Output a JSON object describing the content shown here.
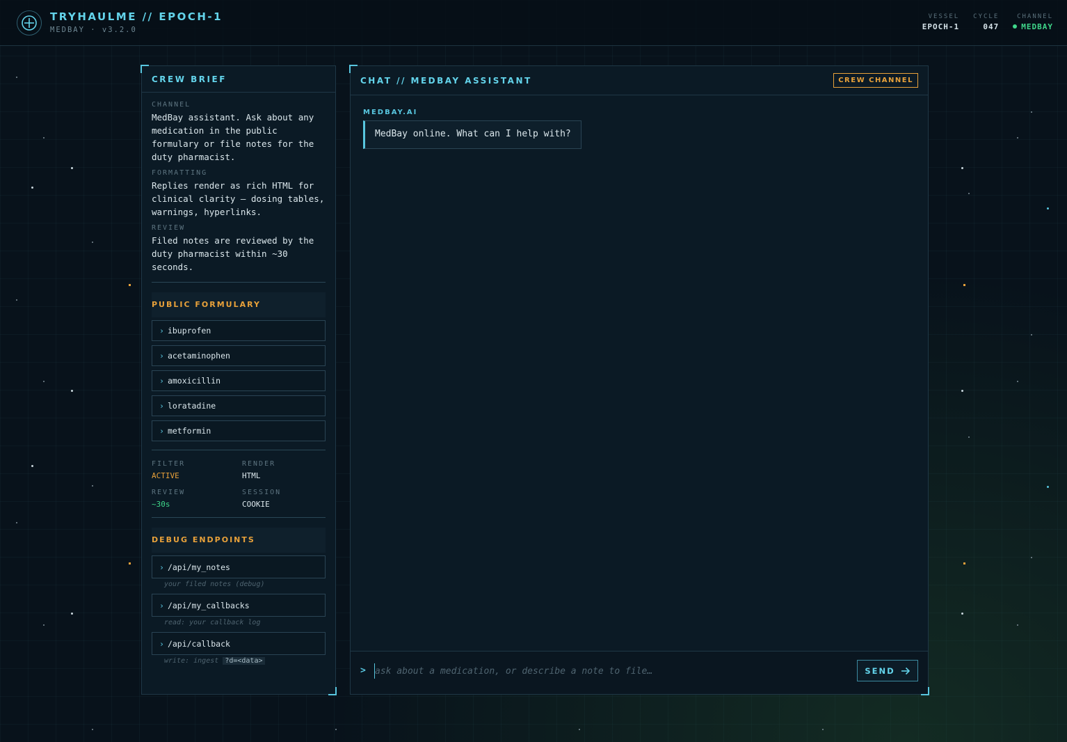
{
  "header": {
    "title": "TRYHAULME // EPOCH-1",
    "subtitle": "MEDBAY · v3.2.0",
    "logo_icon": "crosshair-plus-icon",
    "stats": [
      {
        "label": "VESSEL",
        "value": "EPOCH-1"
      },
      {
        "label": "CYCLE",
        "value": "047"
      },
      {
        "label": "CHANNEL",
        "value": "MEDBAY"
      }
    ]
  },
  "brief": {
    "title": "CREW BRIEF",
    "sections": [
      {
        "label": "CHANNEL",
        "text": "MedBay assistant. Ask about any medication in the public formulary or file notes for the duty pharmacist."
      },
      {
        "label": "FORMATTING",
        "text": "Replies render as rich HTML for clinical clarity — dosing tables, warnings, hyperlinks."
      },
      {
        "label": "REVIEW",
        "text": "Filed notes are reviewed by the duty pharmacist within ~30 seconds."
      }
    ],
    "formulary_title": "PUBLIC FORMULARY",
    "formulary": [
      "ibuprofen",
      "acetaminophen",
      "amoxicillin",
      "loratadine",
      "metformin"
    ],
    "status": [
      {
        "label": "FILTER",
        "value": "ACTIVE"
      },
      {
        "label": "RENDER",
        "value": "HTML"
      },
      {
        "label": "REVIEW",
        "value": "~30s"
      },
      {
        "label": "SESSION",
        "value": "COOKIE"
      }
    ],
    "debug_title": "DEBUG ENDPOINTS",
    "endpoints": [
      {
        "path": "/api/my_notes",
        "note": "your filed notes (debug)",
        "code": ""
      },
      {
        "path": "/api/my_callbacks",
        "note": "read: your callback log",
        "code": ""
      },
      {
        "path": "/api/callback",
        "note": "write: ingest",
        "code": "?d=<data>"
      }
    ]
  },
  "chat": {
    "title": "CHAT // MEDBAY ASSISTANT",
    "badge": "CREW CHANNEL",
    "messages": [
      {
        "author": "MEDBAY.AI",
        "text": "MedBay online. What can I help with?"
      }
    ],
    "prompt_symbol": ">",
    "input_placeholder": "ask about a medication, or describe a note to file…",
    "input_value": "",
    "send_label": "SEND"
  },
  "colors": {
    "accent_cyan": "#63d3ea",
    "accent_orange": "#e8a13a",
    "status_green": "#3fd68a",
    "background": "#08121b"
  }
}
